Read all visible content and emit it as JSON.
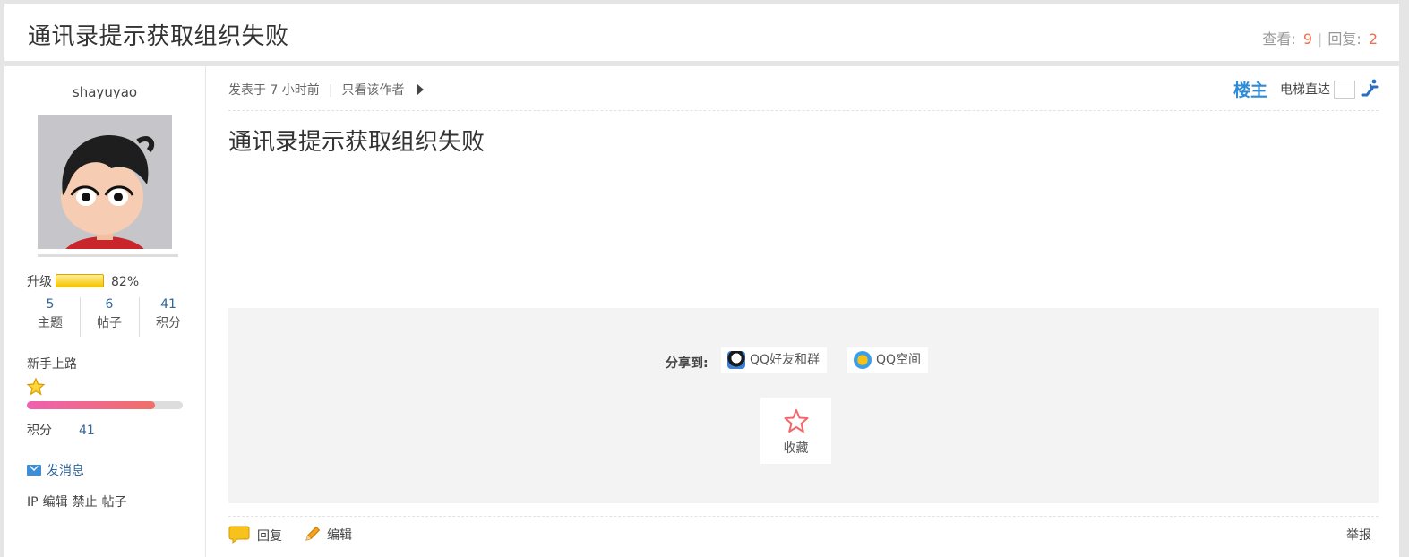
{
  "thread": {
    "title": "通讯录提示获取组织失败",
    "views_label": "查看:",
    "views": "9",
    "replies_label": "回复:",
    "replies": "2"
  },
  "user": {
    "name": "shayuyao",
    "upgrade_label": "升级",
    "upgrade_percent": "82%",
    "stats": [
      {
        "value": "5",
        "label": "主题"
      },
      {
        "value": "6",
        "label": "帖子"
      },
      {
        "value": "41",
        "label": "积分"
      }
    ],
    "rank": "新手上路",
    "credit_progress": 0.82,
    "credits_label": "积分",
    "credits": "41",
    "send_message": "发消息",
    "admin_links": [
      "IP",
      "编辑",
      "禁止",
      "帖子"
    ]
  },
  "post": {
    "posted_at": "发表于 7 小时前",
    "author_only": "只看该作者",
    "floor": "楼主",
    "elevator": "电梯直达",
    "title": "通讯录提示获取组织失败"
  },
  "share": {
    "label": "分享到:",
    "qq_friends": "QQ好友和群",
    "qzone": "QQ空间",
    "favorite": "收藏"
  },
  "actions": {
    "reply": "回复",
    "edit": "编辑",
    "report": "举报"
  },
  "colors": {
    "accent_blue": "#2f8bd6",
    "link": "#336699",
    "count_orange": "#f26c4f"
  }
}
